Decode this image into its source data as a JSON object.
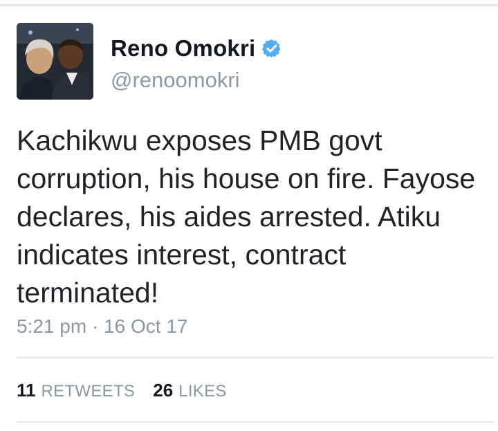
{
  "user": {
    "display_name": "Reno Omokri",
    "handle": "@renoomokri",
    "verified_icon": "verified-badge-icon",
    "verified_color": "#55acee"
  },
  "tweet": {
    "text": "Kachikwu exposes PMB govt\ncorruption, his house on fire. Fayose\ndeclares, his aides arrested. Atiku\nindicates interest, contract\nterminated!",
    "timestamp": "5:21 pm · 16 Oct 17"
  },
  "stats": {
    "retweets_count": "11",
    "retweets_label": "RETWEETS",
    "likes_count": "26",
    "likes_label": "LIKES"
  }
}
